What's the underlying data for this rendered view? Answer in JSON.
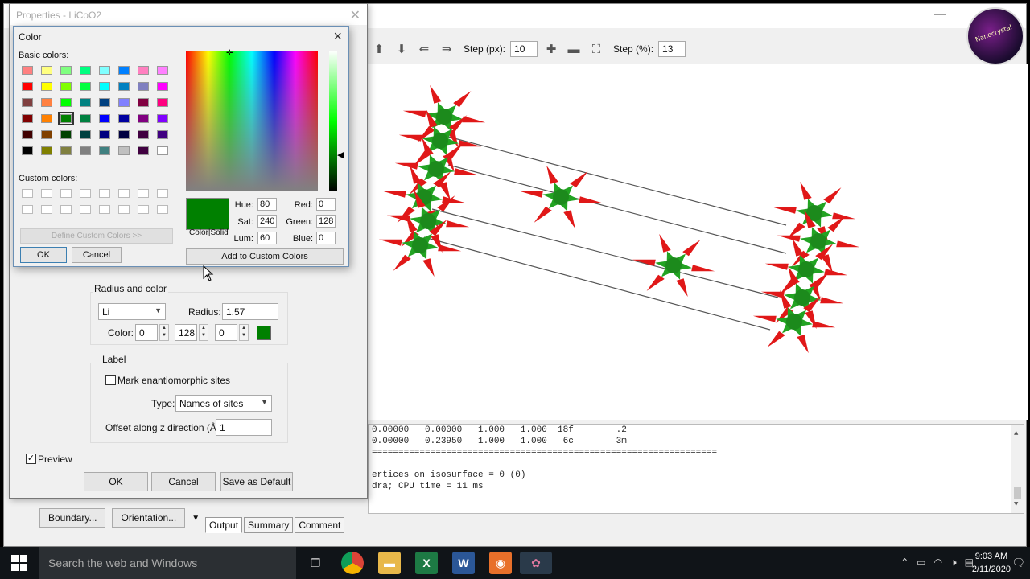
{
  "app": {
    "toolbar": {
      "step_px_label": "Step (px):",
      "step_px_value": "10",
      "step_pct_label": "Step (%):",
      "step_pct_value": "13"
    },
    "output_lines": [
      "0.00000   0.00000   1.000   1.000  18f        .2",
      "0.00000   0.23950   1.000   1.000   6c        3m",
      "=================================================================",
      "",
      "ertices on isosurface = 0 (0)",
      "dra; CPU time = 11 ms"
    ],
    "tabs": [
      "Output",
      "Summary",
      "Comment"
    ],
    "left_buttons": {
      "boundary": "Boundary...",
      "orientation": "Orientation..."
    }
  },
  "props": {
    "title": "Properties - LiCoO2",
    "radius_group": {
      "title": "Radius and color",
      "element": "Li",
      "radius_label": "Radius:",
      "radius_value": "1.57",
      "color_label": "Color:",
      "r": "0",
      "g": "128",
      "b": "0",
      "swatch_color": "#008000"
    },
    "label_group": {
      "title": "Label",
      "mark_label": "Mark enantiomorphic sites",
      "mark_checked": false,
      "type_label": "Type:",
      "type_value": "Names of sites",
      "offset_label": "Offset along z direction (Å):",
      "offset_value": "1"
    },
    "preview_label": "Preview",
    "preview_checked": true,
    "buttons": {
      "ok": "OK",
      "cancel": "Cancel",
      "save_default": "Save as Default"
    }
  },
  "color_dialog": {
    "title": "Color",
    "basic_label": "Basic colors:",
    "custom_label": "Custom colors:",
    "define_btn": "Define Custom Colors >>",
    "ok": "OK",
    "cancel": "Cancel",
    "add_custom": "Add to Custom Colors",
    "color_solid": "Color|Solid",
    "hue_label": "Hue:",
    "hue": "80",
    "sat_label": "Sat:",
    "sat": "240",
    "lum_label": "Lum:",
    "lum": "60",
    "red_label": "Red:",
    "red": "0",
    "green_label": "Green:",
    "green": "128",
    "blue_label": "Blue:",
    "blue": "0",
    "current_color": "#008000",
    "basic_colors": [
      "#ff8080",
      "#ffff80",
      "#80ff80",
      "#00ff80",
      "#80ffff",
      "#0080ff",
      "#ff80c0",
      "#ff80ff",
      "#ff0000",
      "#ffff00",
      "#80ff00",
      "#00ff40",
      "#00ffff",
      "#0080c0",
      "#8080c0",
      "#ff00ff",
      "#804040",
      "#ff8040",
      "#00ff00",
      "#008080",
      "#004080",
      "#8080ff",
      "#800040",
      "#ff0080",
      "#800000",
      "#ff8000",
      "#008000",
      "#008040",
      "#0000ff",
      "#0000a0",
      "#800080",
      "#8000ff",
      "#400000",
      "#804000",
      "#004000",
      "#004040",
      "#000080",
      "#000040",
      "#400040",
      "#400080",
      "#000000",
      "#808000",
      "#808040",
      "#808080",
      "#408080",
      "#c0c0c0",
      "#400040",
      "#ffffff"
    ],
    "selected_index": 26
  },
  "taskbar": {
    "search_placeholder": "Search the web and Windows",
    "time": "9:03 AM",
    "date": "2/11/2020"
  }
}
